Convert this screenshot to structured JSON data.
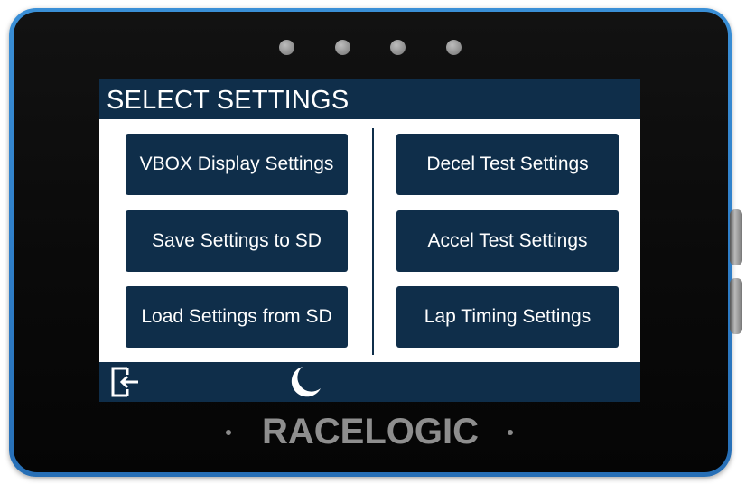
{
  "screen": {
    "title": "SELECT SETTINGS",
    "left_buttons": [
      {
        "label": "VBOX Display Settings"
      },
      {
        "label": "Save Settings to SD"
      },
      {
        "label": "Load Settings from SD"
      }
    ],
    "right_buttons": [
      {
        "label": "Decel Test Settings"
      },
      {
        "label": "Accel Test Settings"
      },
      {
        "label": "Lap Timing Settings"
      }
    ],
    "bottom_bar": {
      "exit_icon": "exit-icon",
      "night_mode_icon": "moon-icon"
    }
  },
  "device": {
    "brand": "RACELOGIC",
    "colors": {
      "rim": "#2f7fc9",
      "screen_accent": "#0f2e4a",
      "body": "#0a0a0a"
    }
  }
}
